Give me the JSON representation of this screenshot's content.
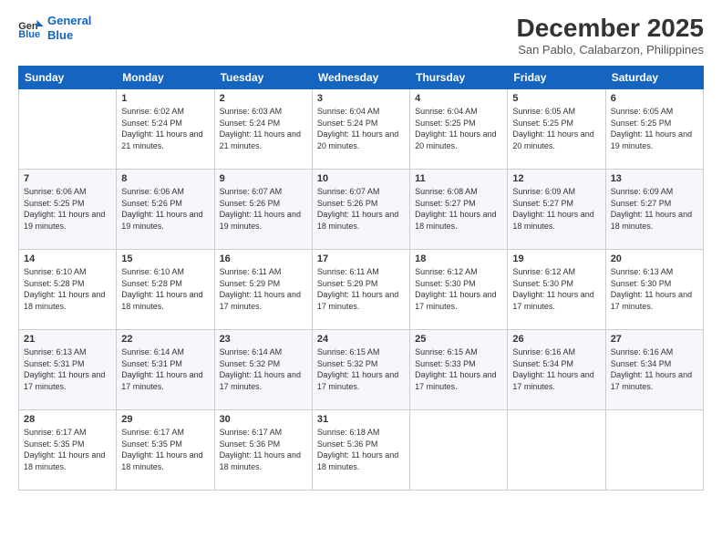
{
  "header": {
    "logo_line1": "General",
    "logo_line2": "Blue",
    "month": "December 2025",
    "location": "San Pablo, Calabarzon, Philippines"
  },
  "days_of_week": [
    "Sunday",
    "Monday",
    "Tuesday",
    "Wednesday",
    "Thursday",
    "Friday",
    "Saturday"
  ],
  "weeks": [
    [
      {
        "day": "",
        "sunrise": "",
        "sunset": "",
        "daylight": ""
      },
      {
        "day": "1",
        "sunrise": "6:02 AM",
        "sunset": "5:24 PM",
        "daylight": "11 hours and 21 minutes."
      },
      {
        "day": "2",
        "sunrise": "6:03 AM",
        "sunset": "5:24 PM",
        "daylight": "11 hours and 21 minutes."
      },
      {
        "day": "3",
        "sunrise": "6:04 AM",
        "sunset": "5:24 PM",
        "daylight": "11 hours and 20 minutes."
      },
      {
        "day": "4",
        "sunrise": "6:04 AM",
        "sunset": "5:25 PM",
        "daylight": "11 hours and 20 minutes."
      },
      {
        "day": "5",
        "sunrise": "6:05 AM",
        "sunset": "5:25 PM",
        "daylight": "11 hours and 20 minutes."
      },
      {
        "day": "6",
        "sunrise": "6:05 AM",
        "sunset": "5:25 PM",
        "daylight": "11 hours and 19 minutes."
      }
    ],
    [
      {
        "day": "7",
        "sunrise": "6:06 AM",
        "sunset": "5:25 PM",
        "daylight": "11 hours and 19 minutes."
      },
      {
        "day": "8",
        "sunrise": "6:06 AM",
        "sunset": "5:26 PM",
        "daylight": "11 hours and 19 minutes."
      },
      {
        "day": "9",
        "sunrise": "6:07 AM",
        "sunset": "5:26 PM",
        "daylight": "11 hours and 19 minutes."
      },
      {
        "day": "10",
        "sunrise": "6:07 AM",
        "sunset": "5:26 PM",
        "daylight": "11 hours and 18 minutes."
      },
      {
        "day": "11",
        "sunrise": "6:08 AM",
        "sunset": "5:27 PM",
        "daylight": "11 hours and 18 minutes."
      },
      {
        "day": "12",
        "sunrise": "6:09 AM",
        "sunset": "5:27 PM",
        "daylight": "11 hours and 18 minutes."
      },
      {
        "day": "13",
        "sunrise": "6:09 AM",
        "sunset": "5:27 PM",
        "daylight": "11 hours and 18 minutes."
      }
    ],
    [
      {
        "day": "14",
        "sunrise": "6:10 AM",
        "sunset": "5:28 PM",
        "daylight": "11 hours and 18 minutes."
      },
      {
        "day": "15",
        "sunrise": "6:10 AM",
        "sunset": "5:28 PM",
        "daylight": "11 hours and 18 minutes."
      },
      {
        "day": "16",
        "sunrise": "6:11 AM",
        "sunset": "5:29 PM",
        "daylight": "11 hours and 17 minutes."
      },
      {
        "day": "17",
        "sunrise": "6:11 AM",
        "sunset": "5:29 PM",
        "daylight": "11 hours and 17 minutes."
      },
      {
        "day": "18",
        "sunrise": "6:12 AM",
        "sunset": "5:30 PM",
        "daylight": "11 hours and 17 minutes."
      },
      {
        "day": "19",
        "sunrise": "6:12 AM",
        "sunset": "5:30 PM",
        "daylight": "11 hours and 17 minutes."
      },
      {
        "day": "20",
        "sunrise": "6:13 AM",
        "sunset": "5:30 PM",
        "daylight": "11 hours and 17 minutes."
      }
    ],
    [
      {
        "day": "21",
        "sunrise": "6:13 AM",
        "sunset": "5:31 PM",
        "daylight": "11 hours and 17 minutes."
      },
      {
        "day": "22",
        "sunrise": "6:14 AM",
        "sunset": "5:31 PM",
        "daylight": "11 hours and 17 minutes."
      },
      {
        "day": "23",
        "sunrise": "6:14 AM",
        "sunset": "5:32 PM",
        "daylight": "11 hours and 17 minutes."
      },
      {
        "day": "24",
        "sunrise": "6:15 AM",
        "sunset": "5:32 PM",
        "daylight": "11 hours and 17 minutes."
      },
      {
        "day": "25",
        "sunrise": "6:15 AM",
        "sunset": "5:33 PM",
        "daylight": "11 hours and 17 minutes."
      },
      {
        "day": "26",
        "sunrise": "6:16 AM",
        "sunset": "5:34 PM",
        "daylight": "11 hours and 17 minutes."
      },
      {
        "day": "27",
        "sunrise": "6:16 AM",
        "sunset": "5:34 PM",
        "daylight": "11 hours and 17 minutes."
      }
    ],
    [
      {
        "day": "28",
        "sunrise": "6:17 AM",
        "sunset": "5:35 PM",
        "daylight": "11 hours and 18 minutes."
      },
      {
        "day": "29",
        "sunrise": "6:17 AM",
        "sunset": "5:35 PM",
        "daylight": "11 hours and 18 minutes."
      },
      {
        "day": "30",
        "sunrise": "6:17 AM",
        "sunset": "5:36 PM",
        "daylight": "11 hours and 18 minutes."
      },
      {
        "day": "31",
        "sunrise": "6:18 AM",
        "sunset": "5:36 PM",
        "daylight": "11 hours and 18 minutes."
      },
      {
        "day": "",
        "sunrise": "",
        "sunset": "",
        "daylight": ""
      },
      {
        "day": "",
        "sunrise": "",
        "sunset": "",
        "daylight": ""
      },
      {
        "day": "",
        "sunrise": "",
        "sunset": "",
        "daylight": ""
      }
    ]
  ]
}
